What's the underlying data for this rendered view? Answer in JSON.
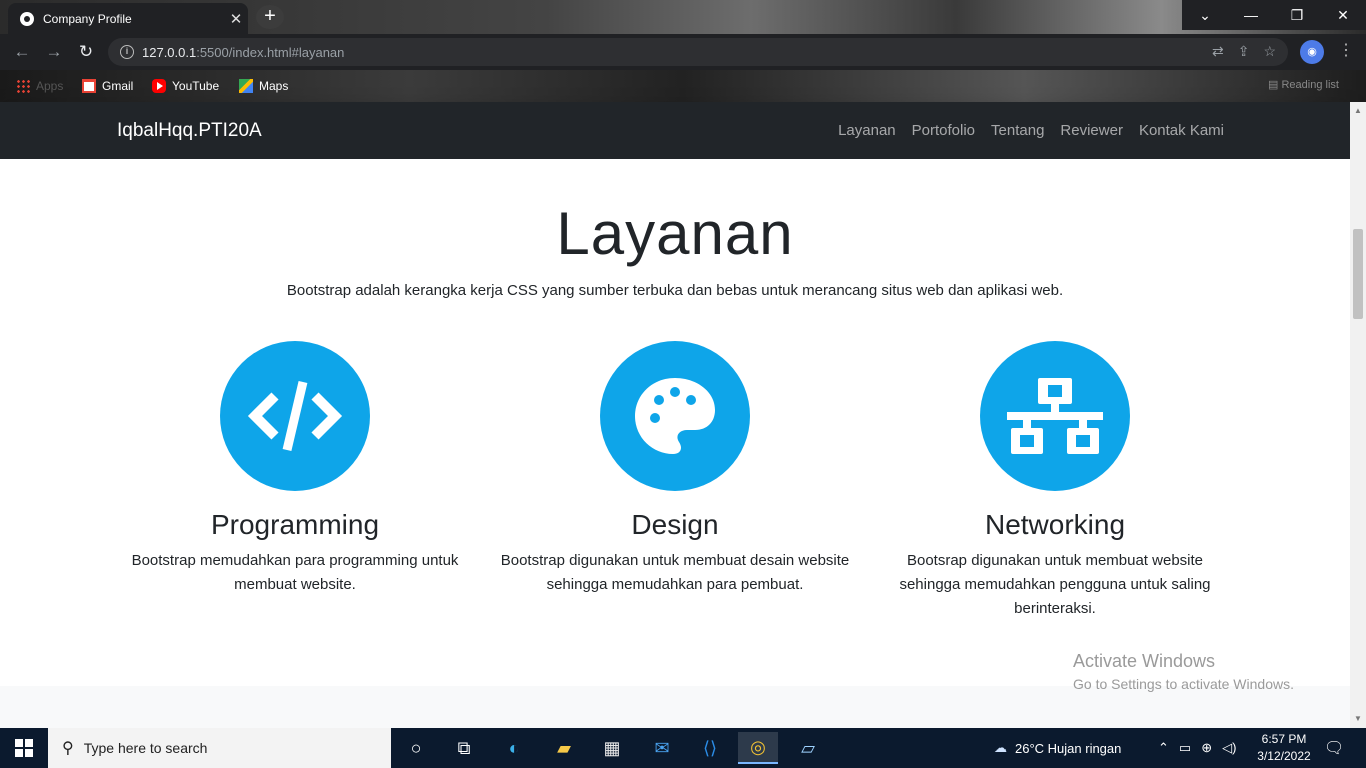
{
  "browser": {
    "tab_title": "Company Profile",
    "tab_close": "✕",
    "new_tab": "+",
    "url_host": "127.0.0.1",
    "url_rest": ":5500/index.html#layanan",
    "bookmarks": [
      {
        "label": "Apps",
        "icon": "apps-grid-icon"
      },
      {
        "label": "Gmail",
        "icon": "gmail-icon"
      },
      {
        "label": "YouTube",
        "icon": "youtube-icon"
      },
      {
        "label": "Maps",
        "icon": "maps-icon"
      }
    ],
    "reading_list": "Reading list"
  },
  "site": {
    "brand": "IqbalHqq.PTI20A",
    "menu": [
      "Layanan",
      "Portofolio",
      "Tentang",
      "Reviewer",
      "Kontak Kami"
    ],
    "section": {
      "title": "Layanan",
      "lead": "Bootstrap adalah kerangka kerja CSS yang sumber terbuka dan bebas untuk merancang situs web dan aplikasi web."
    },
    "services": [
      {
        "title": "Programming",
        "text": "Bootstrap memudahkan para programming untuk membuat website.",
        "icon": "code-icon"
      },
      {
        "title": "Design",
        "text": "Bootstrap digunakan untuk membuat desain website sehingga memudahkan para pembuat.",
        "icon": "palette-icon"
      },
      {
        "title": "Networking",
        "text": "Bootsrap digunakan untuk membuat website sehingga memudahkan pengguna untuk saling berinteraksi.",
        "icon": "network-icon"
      }
    ],
    "accent": "#0ea5e9",
    "nav_bg": "#212529"
  },
  "watermark": {
    "line1": "Activate Windows",
    "line2": "Go to Settings to activate Windows."
  },
  "taskbar": {
    "search_placeholder": "Type here to search",
    "weather": "26°C  Hujan ringan",
    "time": "6:57 PM",
    "date": "3/12/2022"
  }
}
